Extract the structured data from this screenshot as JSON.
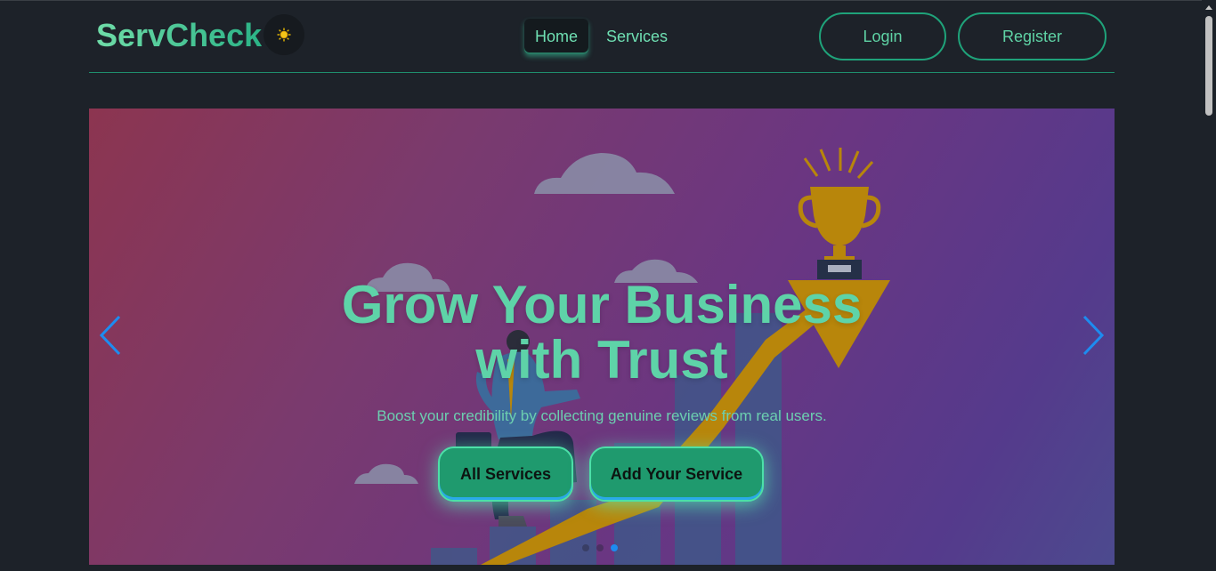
{
  "brand": {
    "name": "ServCheck",
    "theme_icon": "sun-icon"
  },
  "nav": {
    "links": [
      {
        "label": "Home",
        "active": true
      },
      {
        "label": "Services",
        "active": false
      }
    ],
    "login_label": "Login",
    "register_label": "Register"
  },
  "hero": {
    "title_line1": "Grow Your Business",
    "title_line2": "with Trust",
    "subtitle": "Boost your credibility by collecting genuine reviews from real users.",
    "primary_button": "All Services",
    "secondary_button": "Add Your Service",
    "slides": 3,
    "active_slide": 3
  },
  "colors": {
    "accent": "#5fd3a5",
    "background": "#1d2229",
    "button": "#1f9a6e",
    "carousel_arrow": "#1d8cf0"
  }
}
